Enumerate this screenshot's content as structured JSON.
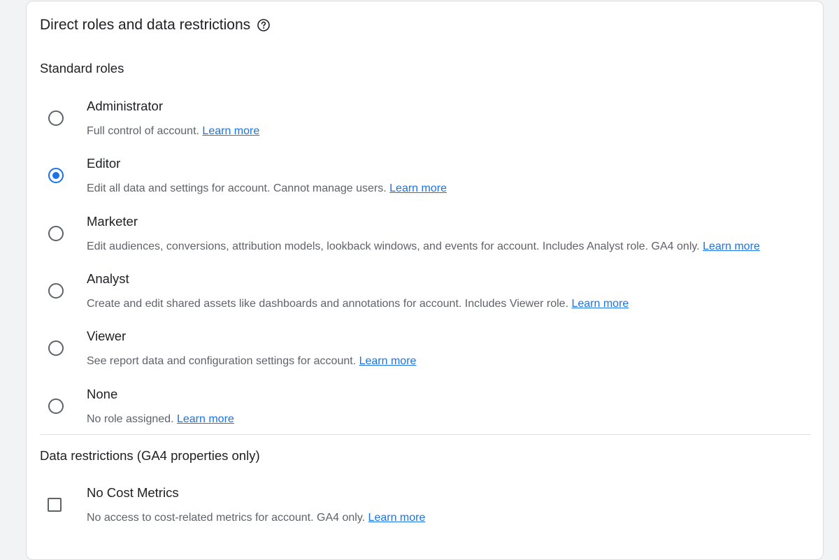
{
  "card": {
    "title": "Direct roles and data restrictions",
    "help_icon": "help-circle-icon"
  },
  "standard_roles": {
    "heading": "Standard roles",
    "selected": "Editor",
    "options": [
      {
        "label": "Administrator",
        "description": "Full control of account.",
        "link": "Learn more",
        "checked": false
      },
      {
        "label": "Editor",
        "description": "Edit all data and settings for account. Cannot manage users.",
        "link": "Learn more",
        "checked": true
      },
      {
        "label": "Marketer",
        "description": "Edit audiences, conversions, attribution models, lookback windows, and events for account. Includes Analyst role. GA4 only.",
        "link": "Learn more",
        "checked": false
      },
      {
        "label": "Analyst",
        "description": "Create and edit shared assets like dashboards and annotations for account. Includes Viewer role.",
        "link": "Learn more",
        "checked": false
      },
      {
        "label": "Viewer",
        "description": "See report data and configuration settings for account.",
        "link": "Learn more",
        "checked": false
      },
      {
        "label": "None",
        "description": "No role assigned.",
        "link": "Learn more",
        "checked": false
      }
    ]
  },
  "data_restrictions": {
    "heading": "Data restrictions (GA4 properties only)",
    "options": [
      {
        "label": "No Cost Metrics",
        "description": "No access to cost-related metrics for account. GA4 only.",
        "link": "Learn more",
        "checked": false
      }
    ]
  },
  "colors": {
    "accent": "#1a73e8",
    "text_primary": "#202124",
    "text_secondary": "#5f6368",
    "background": "#f1f3f4"
  }
}
